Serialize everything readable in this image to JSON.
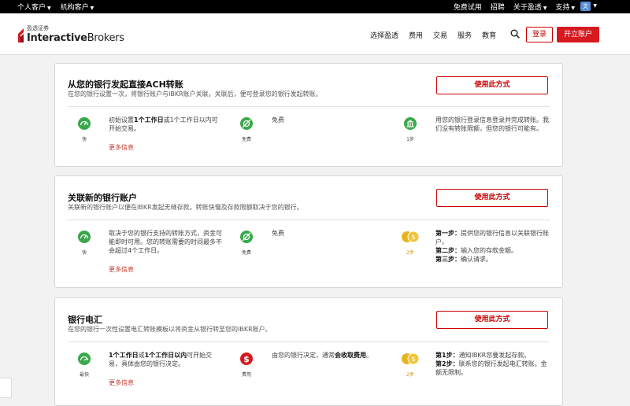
{
  "topbar": {
    "personal": "个人客户",
    "institutional": "机构客户",
    "free_trial": "免费试用",
    "careers": "招聘",
    "about": "关于盈透",
    "support": "支持",
    "lang_icon": "translate-icon"
  },
  "nav": {
    "logo_cn": "盈透证券",
    "logo_en_bold": "Interactive",
    "logo_en_light": "Brokers",
    "items": [
      "选择盈透",
      "费用",
      "交易",
      "服务",
      "教育"
    ],
    "login": "登录",
    "open_account": "开立账户"
  },
  "cards": [
    {
      "title": "从您的银行发起直接ACH转账",
      "subtitle": "在您的银行设置一次，将银行账户与IBKR账户关联。关联后，便可登录您的银行发起转账。",
      "button": "使用此方式",
      "speed_label": "快",
      "speed_desc_pre": "初始设置",
      "speed_desc_b1": "1个工作日",
      "speed_desc_mid": "或1个工作日以内可开始交易。",
      "cost_label": "免费",
      "cost_desc": "免费",
      "steps_label": "1步",
      "steps_desc": "用您的银行登录信息登录并完成转账。我们没有转账限额，但您的银行可能有。",
      "more": "更多信息"
    },
    {
      "title": "关联新的银行账户",
      "subtitle": "关联新的银行账户以便在IBKR发起无缝存款。转账快慢及存款限额取决于您的银行。",
      "button": "使用此方式",
      "speed_label": "快",
      "speed_desc": "取决于您的银行支持的转账方式，资金可能即时可用。您的转账需要的时间最多不会超过4个工作日。",
      "cost_label": "免费",
      "cost_desc": "免费",
      "steps_label": "2步",
      "steps": [
        {
          "k": "第一步：",
          "v": "提供您的银行信息以关联银行账户。"
        },
        {
          "k": "第二步：",
          "v": "输入您的存款金额。"
        },
        {
          "k": "第三步：",
          "v": "确认请求。"
        }
      ],
      "more": "更多信息"
    },
    {
      "title": "银行电汇",
      "subtitle": "在您的银行一次性设置电汇转账模板以将资金从银行转至您的IBKR账户。",
      "button": "使用此方式",
      "speed_label": "最快",
      "speed_desc_b1": "1个工作日",
      "speed_desc_mid": "或",
      "speed_desc_b2": "1个工作日以内",
      "speed_desc_post": "可开始交易，具体由您的银行决定。",
      "cost_label": "费用",
      "cost_desc_pre": "由您的银行决定，通常",
      "cost_desc_b": "会收取费用",
      "cost_desc_post": "。",
      "steps_label": "2步",
      "steps": [
        {
          "k": "第1步：",
          "v": "通知IBKR您要发起存款。"
        },
        {
          "k": "第2步：",
          "v": "联系您的银行发起电汇转账。金额无限制。"
        }
      ],
      "more": "更多信息"
    }
  ],
  "colors": {
    "accent": "#d71920",
    "green": "#3aa84a",
    "gold": "#e8b41e"
  }
}
